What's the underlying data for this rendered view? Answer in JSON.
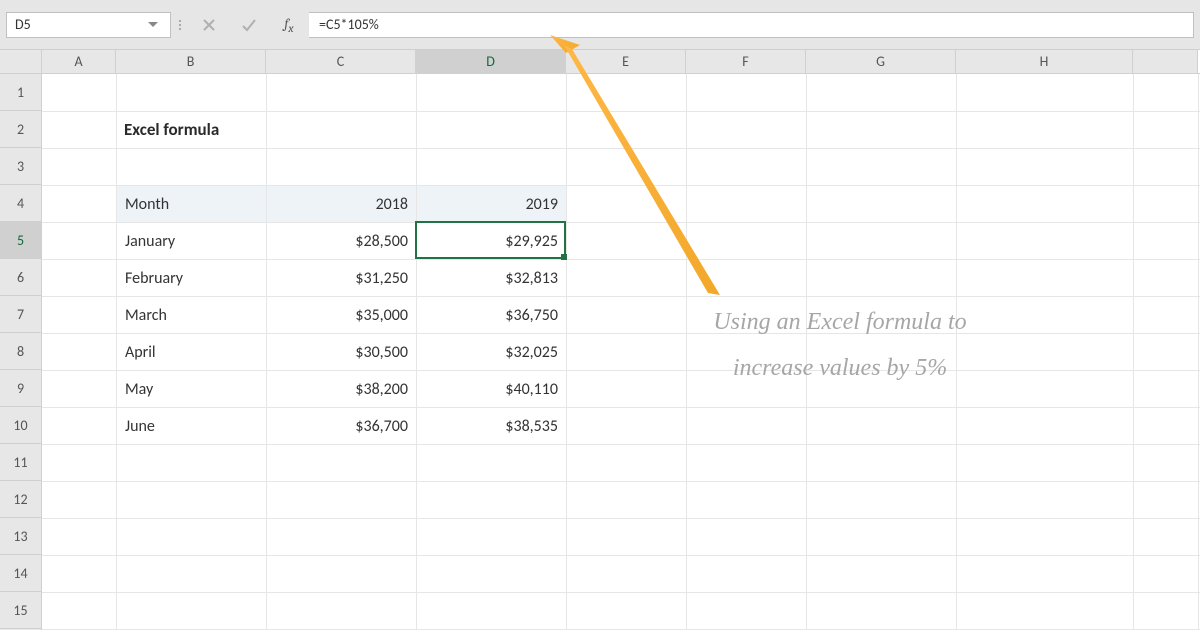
{
  "namebox": "D5",
  "formula": "=C5*105%",
  "columns": [
    "A",
    "B",
    "C",
    "D",
    "E",
    "F",
    "G",
    "H"
  ],
  "active_col": "D",
  "active_row": 5,
  "row_count": 15,
  "title": "Excel formula",
  "table": {
    "headers": {
      "month": "Month",
      "y1": "2018",
      "y2": "2019"
    },
    "rows": [
      {
        "month": "January",
        "y1": "$28,500",
        "y2": "$29,925"
      },
      {
        "month": "February",
        "y1": "$31,250",
        "y2": "$32,813"
      },
      {
        "month": "March",
        "y1": "$35,000",
        "y2": "$36,750"
      },
      {
        "month": "April",
        "y1": "$30,500",
        "y2": "$32,025"
      },
      {
        "month": "May",
        "y1": "$38,200",
        "y2": "$40,110"
      },
      {
        "month": "June",
        "y1": "$36,700",
        "y2": "$38,535"
      }
    ]
  },
  "annotation": {
    "line1": "Using an Excel formula to",
    "line2": "increase values by 5%"
  }
}
